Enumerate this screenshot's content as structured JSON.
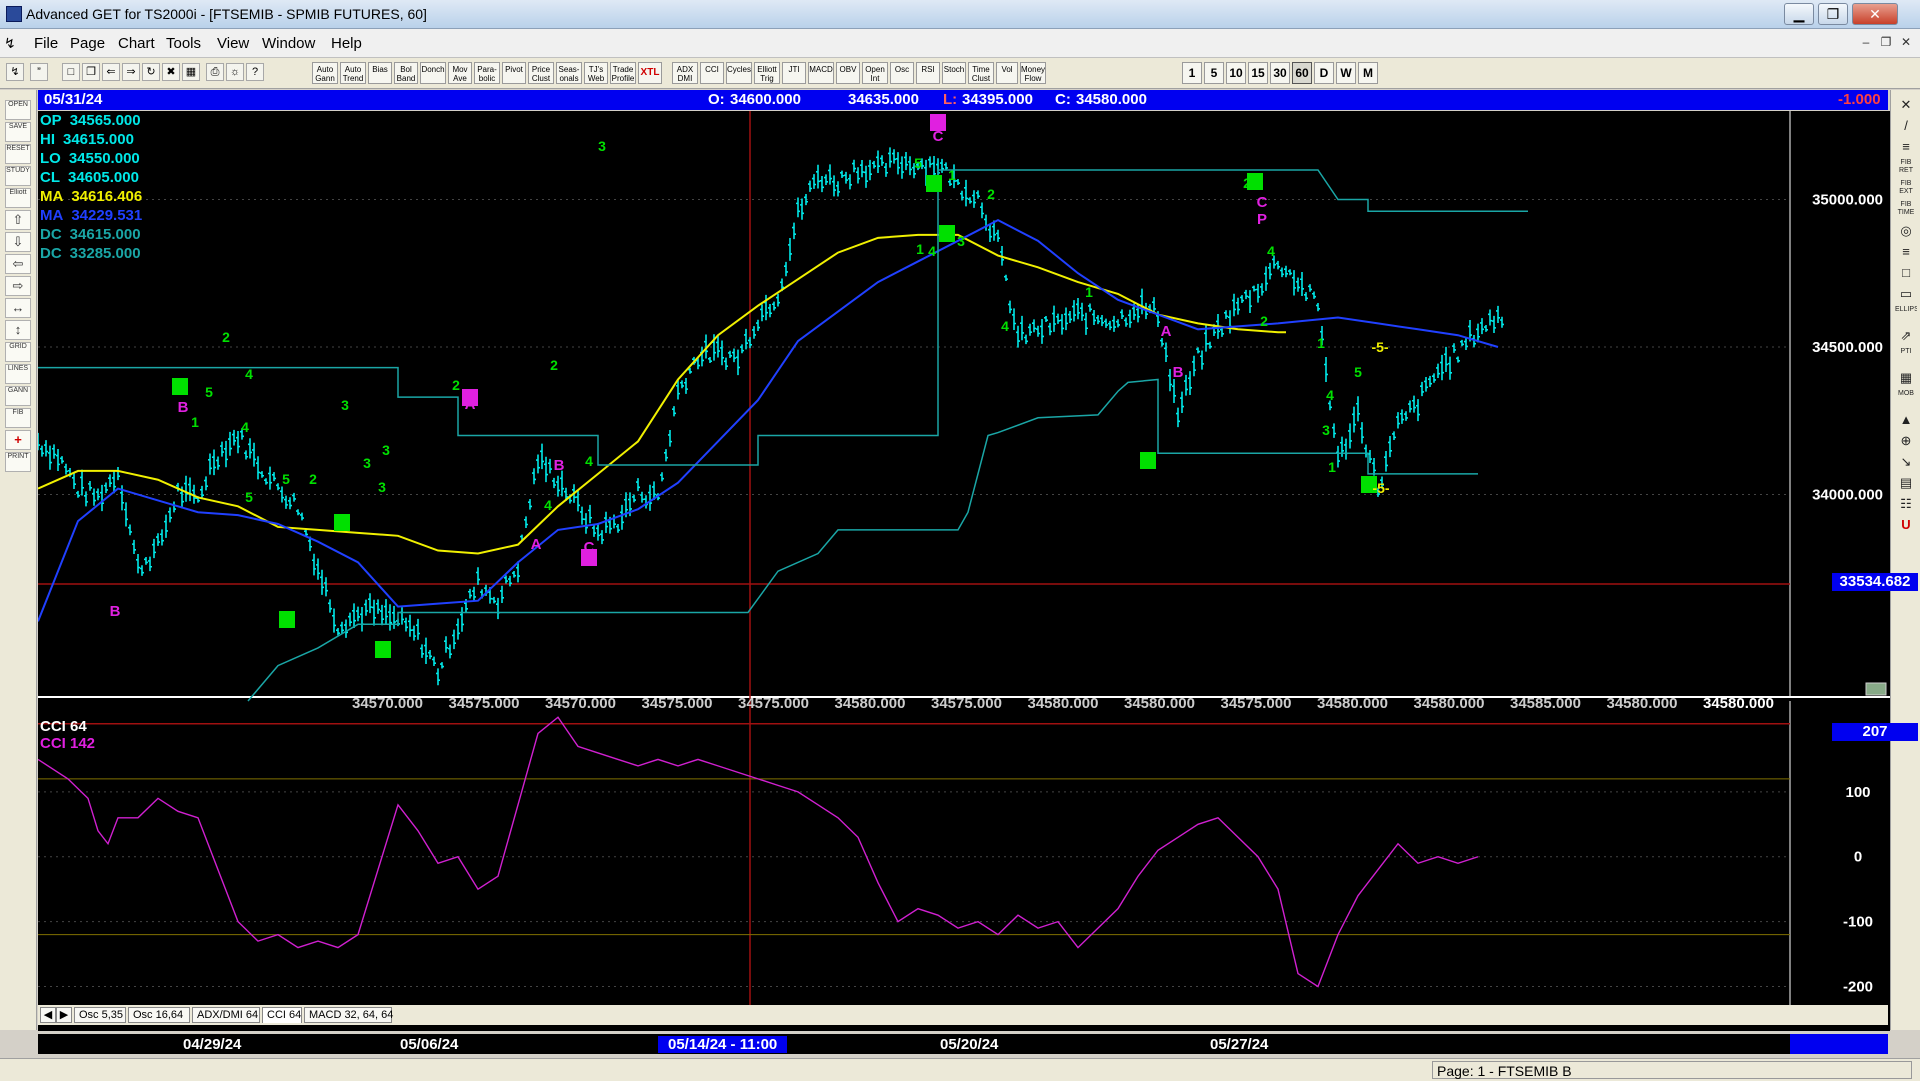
{
  "window": {
    "title": "Advanced GET for TS2000i - [FTSEMIB - SPMIB FUTURES, 60]",
    "minimize": "▁",
    "restore": "❐",
    "close": "✕"
  },
  "menu": {
    "items": [
      "File",
      "Page",
      "Chart",
      "Tools",
      "View",
      "Window",
      "Help"
    ],
    "mdi_minimize": "–",
    "mdi_restore": "❐",
    "mdi_close": "✕"
  },
  "toolbar": {
    "study_buttons": [
      "Auto Gann",
      "Auto Trend",
      "Bias",
      "Bol Band",
      "Donch",
      "Mov Ave",
      "Para-bolic",
      "Pivot",
      "Price Clust",
      "Seas-onals",
      "TJ's Web",
      "Trade Profile",
      "XTL",
      "ADX DMI",
      "CCI",
      "Cycles",
      "Elliott Trig",
      "JTI",
      "MACD",
      "OBV",
      "Open Int",
      "Osc",
      "RSI",
      "Stoch",
      "Time Clust",
      "Vol",
      "Money Flow"
    ],
    "intervals": [
      "1",
      "5",
      "10",
      "15",
      "30",
      "60",
      "D",
      "W",
      "M"
    ],
    "active_interval": "60"
  },
  "left_toolbar": [
    "OPEN",
    "SAVE",
    "RESET",
    "STUDY",
    "Elliott",
    "⇧",
    "⇩",
    "⇦",
    "⇨",
    "↔",
    "↕",
    "GRID",
    "LINES",
    "GANN",
    "FIB",
    "+",
    "PRINT"
  ],
  "right_toolbar": [
    "✕",
    "/",
    "≡",
    "FIB RET",
    "FIB EXT",
    "FIB TIME",
    "◎",
    "≡",
    "□",
    "▭",
    "ELLIPS",
    "⇗",
    "PTI",
    "▦",
    "MOB",
    "▲",
    "⊕",
    "↘",
    "▤",
    "☷",
    "U"
  ],
  "header": {
    "date": "05/31/24",
    "open_label": "O:",
    "open": "34600.000",
    "high": "34635.000",
    "low_label": "L:",
    "low": "34395.000",
    "close_label": "C:",
    "close": "34580.000",
    "change": "-1.000"
  },
  "stats": [
    {
      "label": "OP",
      "value": "34565.000",
      "color": "#00e8e8"
    },
    {
      "label": "HI",
      "value": "34615.000",
      "color": "#00e8e8"
    },
    {
      "label": "LO",
      "value": "34550.000",
      "color": "#00e8e8"
    },
    {
      "label": "CL",
      "value": "34605.000",
      "color": "#00e8e8"
    },
    {
      "label": "MA",
      "value": "34616.406",
      "color": "#f0f000"
    },
    {
      "label": "MA",
      "value": "34229.531",
      "color": "#2040ff"
    },
    {
      "label": "DC",
      "value": "34615.000",
      "color": "#1aa6a6"
    },
    {
      "label": "DC",
      "value": "33285.000",
      "color": "#1aa6a6"
    }
  ],
  "price_axis_labels": [
    "35000.000",
    "34500.000",
    "34000.000"
  ],
  "price_marker": "33534.682",
  "bottom_price_labels": [
    "34570.000",
    "34575.000",
    "34570.000",
    "34575.000",
    "34575.000",
    "34580.000",
    "34575.000",
    "34580.000",
    "34580.000",
    "34575.000",
    "34580.000",
    "34580.000",
    "34585.000",
    "34580.000",
    "34580.000"
  ],
  "wave_labels": {
    "green": [
      "3",
      "2",
      "4",
      "5",
      "1",
      "2",
      "4",
      "3",
      "5",
      "3",
      "2",
      "4",
      "5",
      "1",
      "2",
      "4",
      "3",
      "4",
      "1",
      "2",
      "4",
      "2",
      "1",
      "3",
      "4",
      "5",
      "1",
      "2",
      "3",
      "4",
      "3",
      "5",
      "1"
    ],
    "magenta": [
      "C",
      "B",
      "A",
      "B",
      "A",
      "C",
      "B",
      "A",
      "B",
      "C",
      "P"
    ],
    "yellow": [
      "-5-",
      "-5-"
    ]
  },
  "cci": {
    "title": "CCI 64",
    "value_label": "CCI  142",
    "current_tag": "207",
    "axis_labels": [
      "100",
      "0",
      "-100",
      "-200"
    ]
  },
  "tabs": [
    "Osc 5,35",
    "Osc 16,64",
    "ADX/DMI 64",
    "CCI 64",
    "MACD 32, 64, 64"
  ],
  "active_tab": "CCI 64",
  "date_axis": {
    "labels": [
      "04/29/24",
      "05/06/24",
      "05/20/24",
      "05/27/24"
    ],
    "cursor": "05/14/24 - 11:00"
  },
  "status": {
    "page": "Page: 1 - FTSEMIB B"
  },
  "chart_data": {
    "type": "line",
    "series": [
      {
        "name": "MA",
        "color": "#f0f000"
      },
      {
        "name": "MA",
        "color": "#2040ff"
      },
      {
        "name": "DC",
        "color": "#1aa6a6"
      }
    ],
    "ylim": [
      33300,
      35300
    ]
  },
  "colors": {
    "title_bar": "#c4d8ee",
    "header_bg": "#0000f0",
    "chart_bg": "#000000",
    "price_bars": "#00e8e8",
    "ma_fast": "#f0f000",
    "ma_slow": "#2040ff",
    "donchian": "#1aa6a6",
    "cci_line": "#d020d0",
    "wave_green": "#00e000",
    "wave_magenta": "#e020e0",
    "cursor_line": "#a01010"
  }
}
